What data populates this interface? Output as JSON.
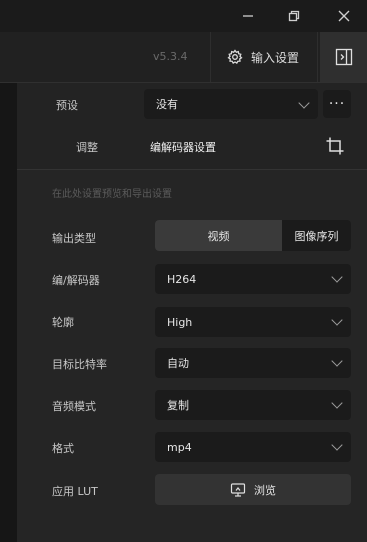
{
  "window": {
    "controls": [
      {
        "name": "minimize",
        "icon": "minimize-icon"
      },
      {
        "name": "restore",
        "icon": "restore-icon"
      },
      {
        "name": "close",
        "icon": "close-icon"
      }
    ]
  },
  "header": {
    "version": "v5.3.4",
    "input_settings_label": "输入设置",
    "input_settings_icon": "gear-icon",
    "panel_toggle_icon": "panel-toggle-icon"
  },
  "preset": {
    "label": "预设",
    "value": "没有",
    "more_label": "···"
  },
  "adjust": {
    "label": "调整",
    "value": "编解码器设置",
    "icon": "crop-icon"
  },
  "hint": "在此处设置预览和导出设置",
  "settings": {
    "output_type": {
      "label": "输出类型",
      "options": [
        "视频",
        "图像序列"
      ],
      "selected": "视频"
    },
    "codec": {
      "label": "编/解码器",
      "value": "H264"
    },
    "profile": {
      "label": "轮廓",
      "value": "High"
    },
    "bitrate": {
      "label": "目标比特率",
      "value": "自动"
    },
    "audio_mode": {
      "label": "音频模式",
      "value": "复制"
    },
    "format": {
      "label": "格式",
      "value": "mp4"
    },
    "lut": {
      "label": "应用 LUT",
      "button_label": "浏览",
      "icon": "monitor-icon"
    }
  },
  "colors": {
    "background": "#252525",
    "field": "#1b1b1b",
    "selected_segment": "#3a3a3a"
  }
}
